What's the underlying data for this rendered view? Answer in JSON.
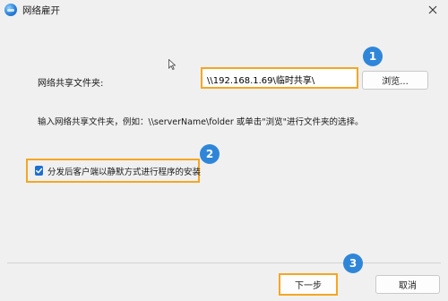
{
  "window": {
    "title": "网络雇开",
    "app_icon": "globe-icon",
    "close_icon": "close-icon"
  },
  "form": {
    "share_label": "网络共享文件夹:",
    "path_value": "\\\\192.168.1.69\\临时共享\\",
    "browse_label": "浏览...",
    "hint": "输入网络共享文件夹，例如：\\\\serverName\\folder 或单击\"浏览\"进行文件夹的选择。",
    "silent_install_label": "分发后客户端以静默方式进行程序的安装",
    "silent_install_checked": true
  },
  "footer": {
    "next_label": "下一步",
    "cancel_label": "取消"
  },
  "annotations": {
    "step1": "1",
    "step2": "2",
    "step3": "3"
  },
  "colors": {
    "highlight": "#f5a623",
    "badge": "#2f86d9",
    "checkbox": "#1f6fd1"
  }
}
